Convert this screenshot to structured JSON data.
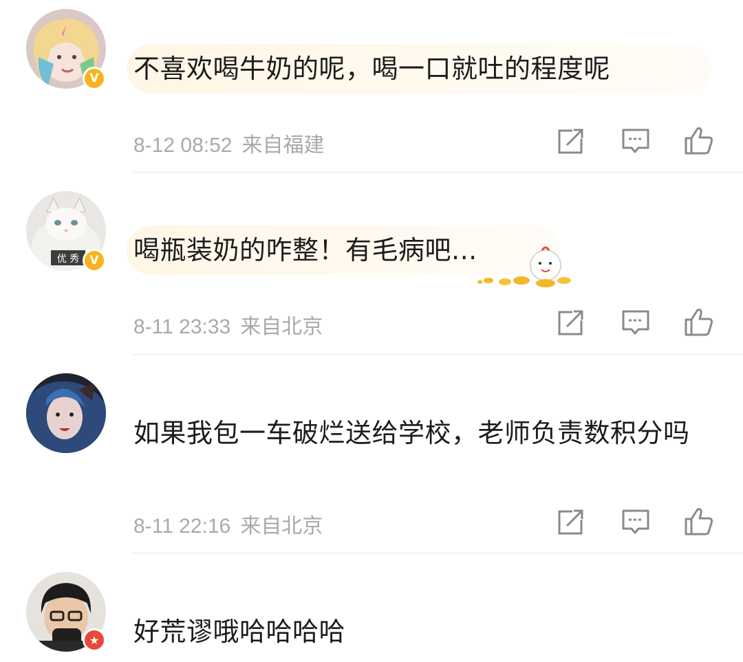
{
  "comments": [
    {
      "text": "不喜欢喝牛奶的呢，喝一口就吐的程度呢",
      "date": "8-12 08:52",
      "location": "来自福建",
      "badge": "V",
      "badge_color": "#f5b41e"
    },
    {
      "text": "喝瓶装奶的咋整！有毛病吧...",
      "date": "8-11 23:33",
      "location": "来自北京",
      "badge": "V",
      "badge_color": "#f5b41e",
      "avatar_caption": "优 秀"
    },
    {
      "text": "如果我包一车破烂送给学校，老师负责数积分吗",
      "date": "8-11 22:16",
      "location": "来自北京"
    },
    {
      "text": "好荒谬哦哈哈哈哈",
      "badge": "★",
      "badge_color": "#e8483a"
    }
  ],
  "icons": {
    "share": "share-icon",
    "reply": "comment-icon",
    "like": "thumbs-up-icon"
  },
  "colors": {
    "meta_text": "#a9a9a9",
    "bubble": "#fff6e6",
    "icon_stroke": "#8a8a8a"
  }
}
